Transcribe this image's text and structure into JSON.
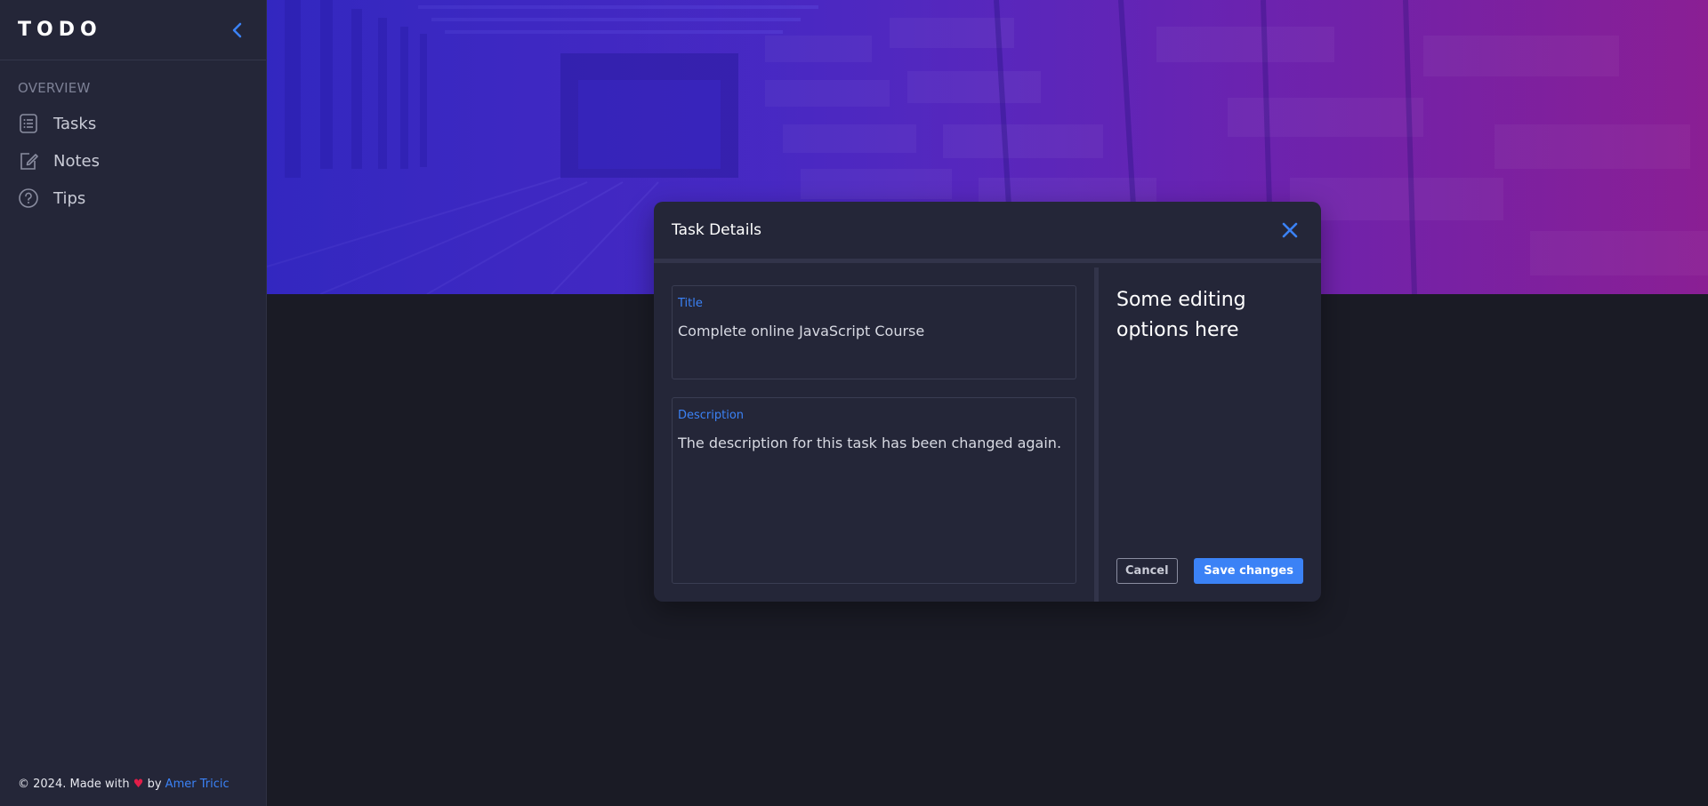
{
  "app": {
    "brand": "TODO"
  },
  "sidebar": {
    "section_label": "OVERVIEW",
    "items": [
      {
        "label": "Tasks",
        "icon": "tasks-list-icon"
      },
      {
        "label": "Notes",
        "icon": "note-edit-icon"
      },
      {
        "label": "Tips",
        "icon": "question-circle-icon"
      }
    ],
    "footer": {
      "prefix": "© 2024. Made with",
      "heart": "♥",
      "by": "by",
      "author": "Amer Tricic"
    }
  },
  "modal": {
    "title": "Task Details",
    "fields": {
      "title_label": "Title",
      "title_value": "Complete online JavaScript Course",
      "description_label": "Description",
      "description_value": "The description for this task has been changed again."
    },
    "options_text": "Some editing options here",
    "cancel_label": "Cancel",
    "save_label": "Save changes"
  },
  "colors": {
    "accent": "#3b82f6",
    "sidebar_bg": "#242638",
    "page_bg": "#1a1b25",
    "heart": "#e11d48"
  }
}
